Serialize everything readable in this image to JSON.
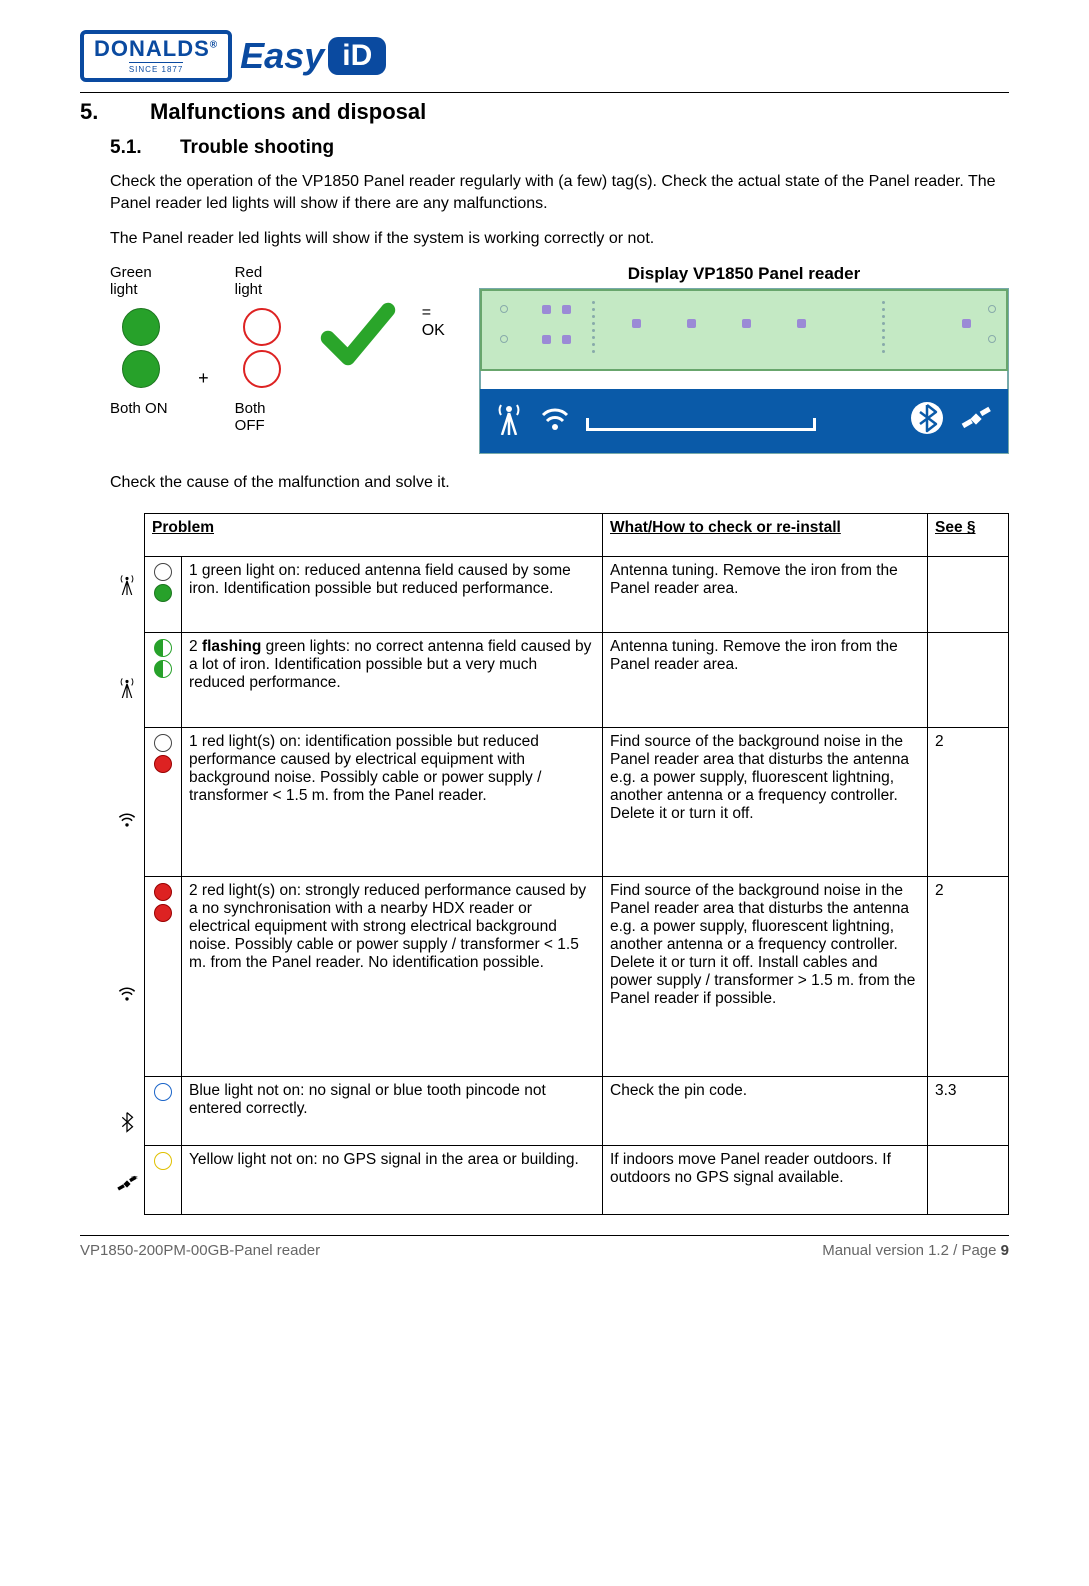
{
  "logo": {
    "brand": "DONALDS",
    "reg": "®",
    "since": "SINCE 1877",
    "easy": "Easy",
    "id": "iD"
  },
  "section": {
    "num": "5.",
    "title": "Malfunctions and disposal"
  },
  "subsection": {
    "num": "5.1.",
    "title": "Trouble shooting"
  },
  "para1": "Check the operation of the VP1850 Panel reader regularly with (a few) tag(s). Check the actual state of the Panel reader. The Panel reader led lights will show if there are any malfunctions.",
  "para2": "The Panel reader led lights will show if the system is working correctly or not.",
  "led_labels": {
    "green": "Green light",
    "red": "Red light",
    "both_on": "Both ON",
    "both_off": "Both OFF",
    "plus": "+",
    "ok": "= OK"
  },
  "display_title": "Display VP1850 Panel reader",
  "para3": "Check the cause of the malfunction and solve it.",
  "table": {
    "headers": {
      "problem": "Problem",
      "check": "What/How to check or re-install",
      "see": "See §"
    },
    "rows": [
      {
        "problem_prefix": "1 green light on: ",
        "problem_rest": "reduced antenna field caused by some iron. Identification possible but reduced performance.",
        "check": "Antenna tuning. Remove the iron from the Panel reader area.",
        "see": ""
      },
      {
        "problem_prefix": "2 ",
        "problem_bold": "flashing",
        "problem_rest": " green lights: no correct antenna field caused by a lot of iron. Identification possible but a very much reduced performance.",
        "check": "Antenna tuning. Remove the iron from the Panel reader area.",
        "see": ""
      },
      {
        "problem": "1 red light(s) on: identification possible but reduced performance caused by electrical equipment with background noise. Possibly cable or power supply / transformer < 1.5 m. from the Panel reader.",
        "check": "Find source of the background noise in the Panel reader area that disturbs the antenna e.g. a power supply, fluorescent lightning, another antenna or a frequency controller. Delete it or turn it off.",
        "see": "2"
      },
      {
        "problem": "2 red light(s) on: strongly reduced performance caused by a no synchronisation with a nearby HDX reader or electrical equipment with strong electrical background noise. Possibly cable or power supply / transformer < 1.5 m. from the Panel reader. No identification possible.",
        "check": "Find source of the background noise in the Panel reader area that disturbs the antenna e.g. a power supply, fluorescent lightning, another antenna or a frequency controller. Delete it or turn it off. Install cables and power supply / transformer > 1.5 m. from the Panel reader if possible.",
        "see": "2"
      },
      {
        "problem": "Blue light not on: no signal or blue tooth pincode not entered correctly.",
        "check": "Check the pin code.",
        "see": "3.3"
      },
      {
        "problem": "Yellow light not on: no GPS signal in the area or building.",
        "check": "If indoors move Panel reader outdoors. If outdoors no GPS signal available.",
        "see": ""
      }
    ]
  },
  "footer": {
    "left": "VP1850-200PM-00GB-Panel reader",
    "right_prefix": "Manual version 1.2 / Page ",
    "right_page": "9"
  }
}
